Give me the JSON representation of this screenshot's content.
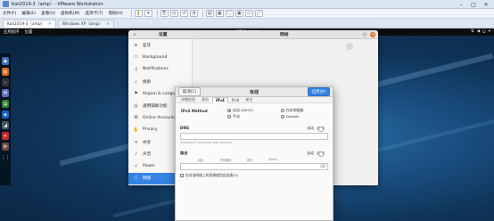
{
  "vmware": {
    "title": "Kali2019-3（amp）- VMware Workstation",
    "menu": [
      "文件(F)",
      "编辑(E)",
      "查看(V)",
      "虚拟机(M)",
      "选项卡(T)",
      "帮助(H)"
    ],
    "tabs": [
      {
        "label": "Kali2019-3（amp）"
      },
      {
        "label": "Windows XP（amp）"
      }
    ]
  },
  "gnome": {
    "activities": "应用程序",
    "places": "位置",
    "clock": "星期三 10:46"
  },
  "settings": {
    "left_title": "设置",
    "right_title": "网络",
    "sidebar": [
      {
        "icon": "≋",
        "label": "蓝牙"
      },
      {
        "icon": "▭",
        "label": "Background"
      },
      {
        "icon": "♫",
        "label": "Notifications"
      },
      {
        "icon": "⌕",
        "label": "搜索"
      },
      {
        "icon": "⚑",
        "label": "Region & Language"
      },
      {
        "icon": "◎",
        "label": "通用辅助功能"
      },
      {
        "icon": "⊞",
        "label": "Online Accounts"
      },
      {
        "icon": "✋",
        "label": "Privacy"
      },
      {
        "icon": "⋖",
        "label": "共享"
      },
      {
        "icon": "♪",
        "label": "声音"
      },
      {
        "icon": "⚡",
        "label": "Power"
      },
      {
        "icon": "⎍",
        "label": "网络"
      }
    ]
  },
  "dialog": {
    "title": "有线",
    "cancel": "取消(C)",
    "apply": "应用(A)",
    "tabs": [
      "详细信息",
      "身份",
      "IPv4",
      "IPv6",
      "安全"
    ],
    "ipv4_method_label": "IPv4 Method",
    "methods": {
      "auto": "自动 (DHCP)",
      "manual": "手动",
      "link_local": "仅本地链路",
      "disable": "Disable"
    },
    "dns_label": "DNS",
    "auto_label": "自动",
    "dns_hint": "Separate IP addresses with commas",
    "routes_label": "路由",
    "routes_auto": "自动",
    "route_cols": [
      "地址",
      "子网掩码",
      "网关",
      "Metric"
    ],
    "only_local_label": "仅对该网络上的资源使用此连接(O)"
  }
}
